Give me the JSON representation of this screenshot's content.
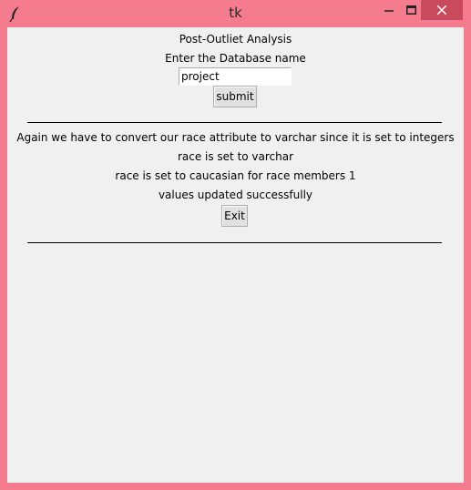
{
  "window": {
    "title": "tk"
  },
  "form": {
    "heading": "Post-Outliet Analysis",
    "db_prompt": "Enter the Database name",
    "db_value": "project",
    "submit_label": "submit"
  },
  "results": {
    "line1": "Again we have to convert our race attribute to varchar since it is set to integers",
    "line2": "race is set to varchar",
    "line3": "race is set to caucasian for race members 1",
    "line4": "values updated successfully",
    "exit_label": "Exit"
  },
  "colors": {
    "titlebar": "#f57c8f",
    "close_button": "#c94a5c",
    "client_bg": "#f0f0f0"
  }
}
